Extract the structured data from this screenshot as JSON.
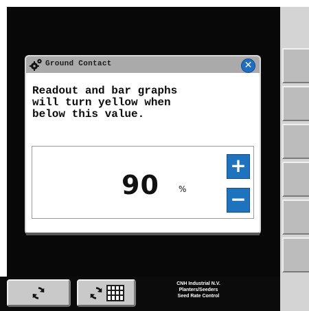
{
  "dialog": {
    "title": "Ground Contact",
    "message": "Readout and bar graphs\nwill turn yellow when\nbelow this value.",
    "value": "90",
    "unit": "%",
    "increment_label": "+",
    "decrement_label": "−"
  },
  "footer": {
    "company_lines": [
      "CNH Industrial N.V.",
      "Planters/Seeders",
      "Seed Rate Control"
    ]
  },
  "icons": {
    "title_icon": "gear-icon",
    "close_icon": "close-icon",
    "footer_button_1": "sync-icon",
    "footer_button_2": [
      "sync-icon",
      "grid-icon"
    ]
  },
  "colors": {
    "accent_blue": "#1e73bf",
    "title_bar": "#aaaaaa",
    "screen_bg": "#080808"
  }
}
